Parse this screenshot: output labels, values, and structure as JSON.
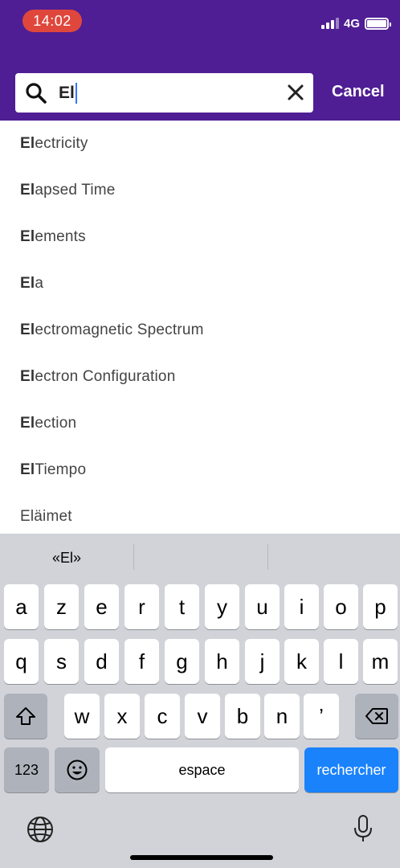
{
  "status_bar": {
    "time": "14:02",
    "network": "4G"
  },
  "search": {
    "query": "El",
    "cancel_label": "Cancel"
  },
  "results": [
    {
      "match": "El",
      "rest": "ectricity"
    },
    {
      "match": "El",
      "rest": "apsed Time"
    },
    {
      "match": "El",
      "rest": "ements"
    },
    {
      "match": "El",
      "rest": "a"
    },
    {
      "match": "El",
      "rest": "ectromagnetic Spectrum"
    },
    {
      "match": "El",
      "rest": "ectron Configuration"
    },
    {
      "match": "El",
      "rest": "ection"
    },
    {
      "match": "El",
      "rest": " Tiempo"
    },
    {
      "match": "",
      "rest": "Eläimet"
    }
  ],
  "keyboard": {
    "suggestions": [
      "«El»",
      "",
      ""
    ],
    "row1": [
      "a",
      "z",
      "e",
      "r",
      "t",
      "y",
      "u",
      "i",
      "o",
      "p"
    ],
    "row2": [
      "q",
      "s",
      "d",
      "f",
      "g",
      "h",
      "j",
      "k",
      "l",
      "m"
    ],
    "row3": [
      "w",
      "x",
      "c",
      "v",
      "b",
      "n",
      "’"
    ],
    "numbers_label": "123",
    "space_label": "espace",
    "search_label": "rechercher"
  },
  "colors": {
    "header": "#4f1e94",
    "time_pill": "#e0473c",
    "search_key": "#1a82fb",
    "keyboard_bg": "#d1d3d9"
  }
}
